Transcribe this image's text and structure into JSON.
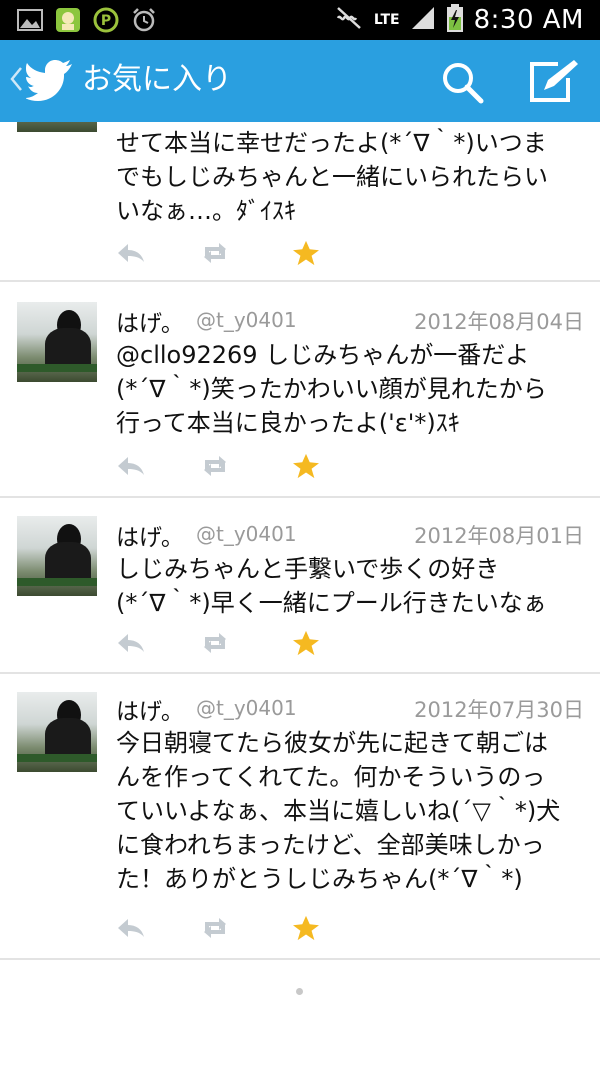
{
  "status_bar": {
    "network": "LTE",
    "time": "8:30 AM"
  },
  "app_bar": {
    "title": "お気に入り"
  },
  "tweets": [
    {
      "text_lines": [
        "せて本当に幸せだったよ(*´∇｀*)いつま",
        "でもしじみちゃんと一緒にいられたらい",
        "いなぁ…。ﾀﾞｲｽｷ"
      ],
      "favorited": true
    },
    {
      "name": "はげ。",
      "handle": "@t_y0401",
      "date": "2012年08月04日",
      "text_lines": [
        "@cllo92269 しじみちゃんが一番だよ",
        "(*´∇｀*)笑ったかわいい顔が見れたから",
        "行って本当に良かったよ('ε'*)ｽｷ"
      ],
      "favorited": true
    },
    {
      "name": "はげ。",
      "handle": "@t_y0401",
      "date": "2012年08月01日",
      "text_lines": [
        "しじみちゃんと手繋いで歩くの好き",
        "(*´∇｀*)早く一緒にプール行きたいなぁ"
      ],
      "favorited": true
    },
    {
      "name": "はげ。",
      "handle": "@t_y0401",
      "date": "2012年07月30日",
      "text_lines": [
        "今日朝寝てたら彼女が先に起きて朝ごは",
        "んを作ってくれてた。何かそういうのっ",
        "ていいよなぁ、本当に嬉しいね(´▽｀*)犬",
        "に食われちまったけど、全部美味しかっ",
        "た！ありがとうしじみちゃん(*´∇｀*)"
      ],
      "favorited": true
    }
  ],
  "colors": {
    "app_bar": "#2a9fe0",
    "favorite_star": "#f5b921",
    "meta_text": "#9a9a9a",
    "action_icon": "#c4cbd1"
  },
  "icons": {
    "status_left": [
      "gallery-icon",
      "app-icon",
      "parking-app-icon",
      "alarm-icon"
    ],
    "status_right": [
      "mute-icon",
      "signal-icon",
      "battery-charging-icon"
    ],
    "app_bar": [
      "back-chevron-icon",
      "twitter-bird-icon",
      "search-icon",
      "compose-icon"
    ],
    "tweet_actions": [
      "reply-icon",
      "retweet-icon",
      "favorite-star-icon"
    ]
  }
}
